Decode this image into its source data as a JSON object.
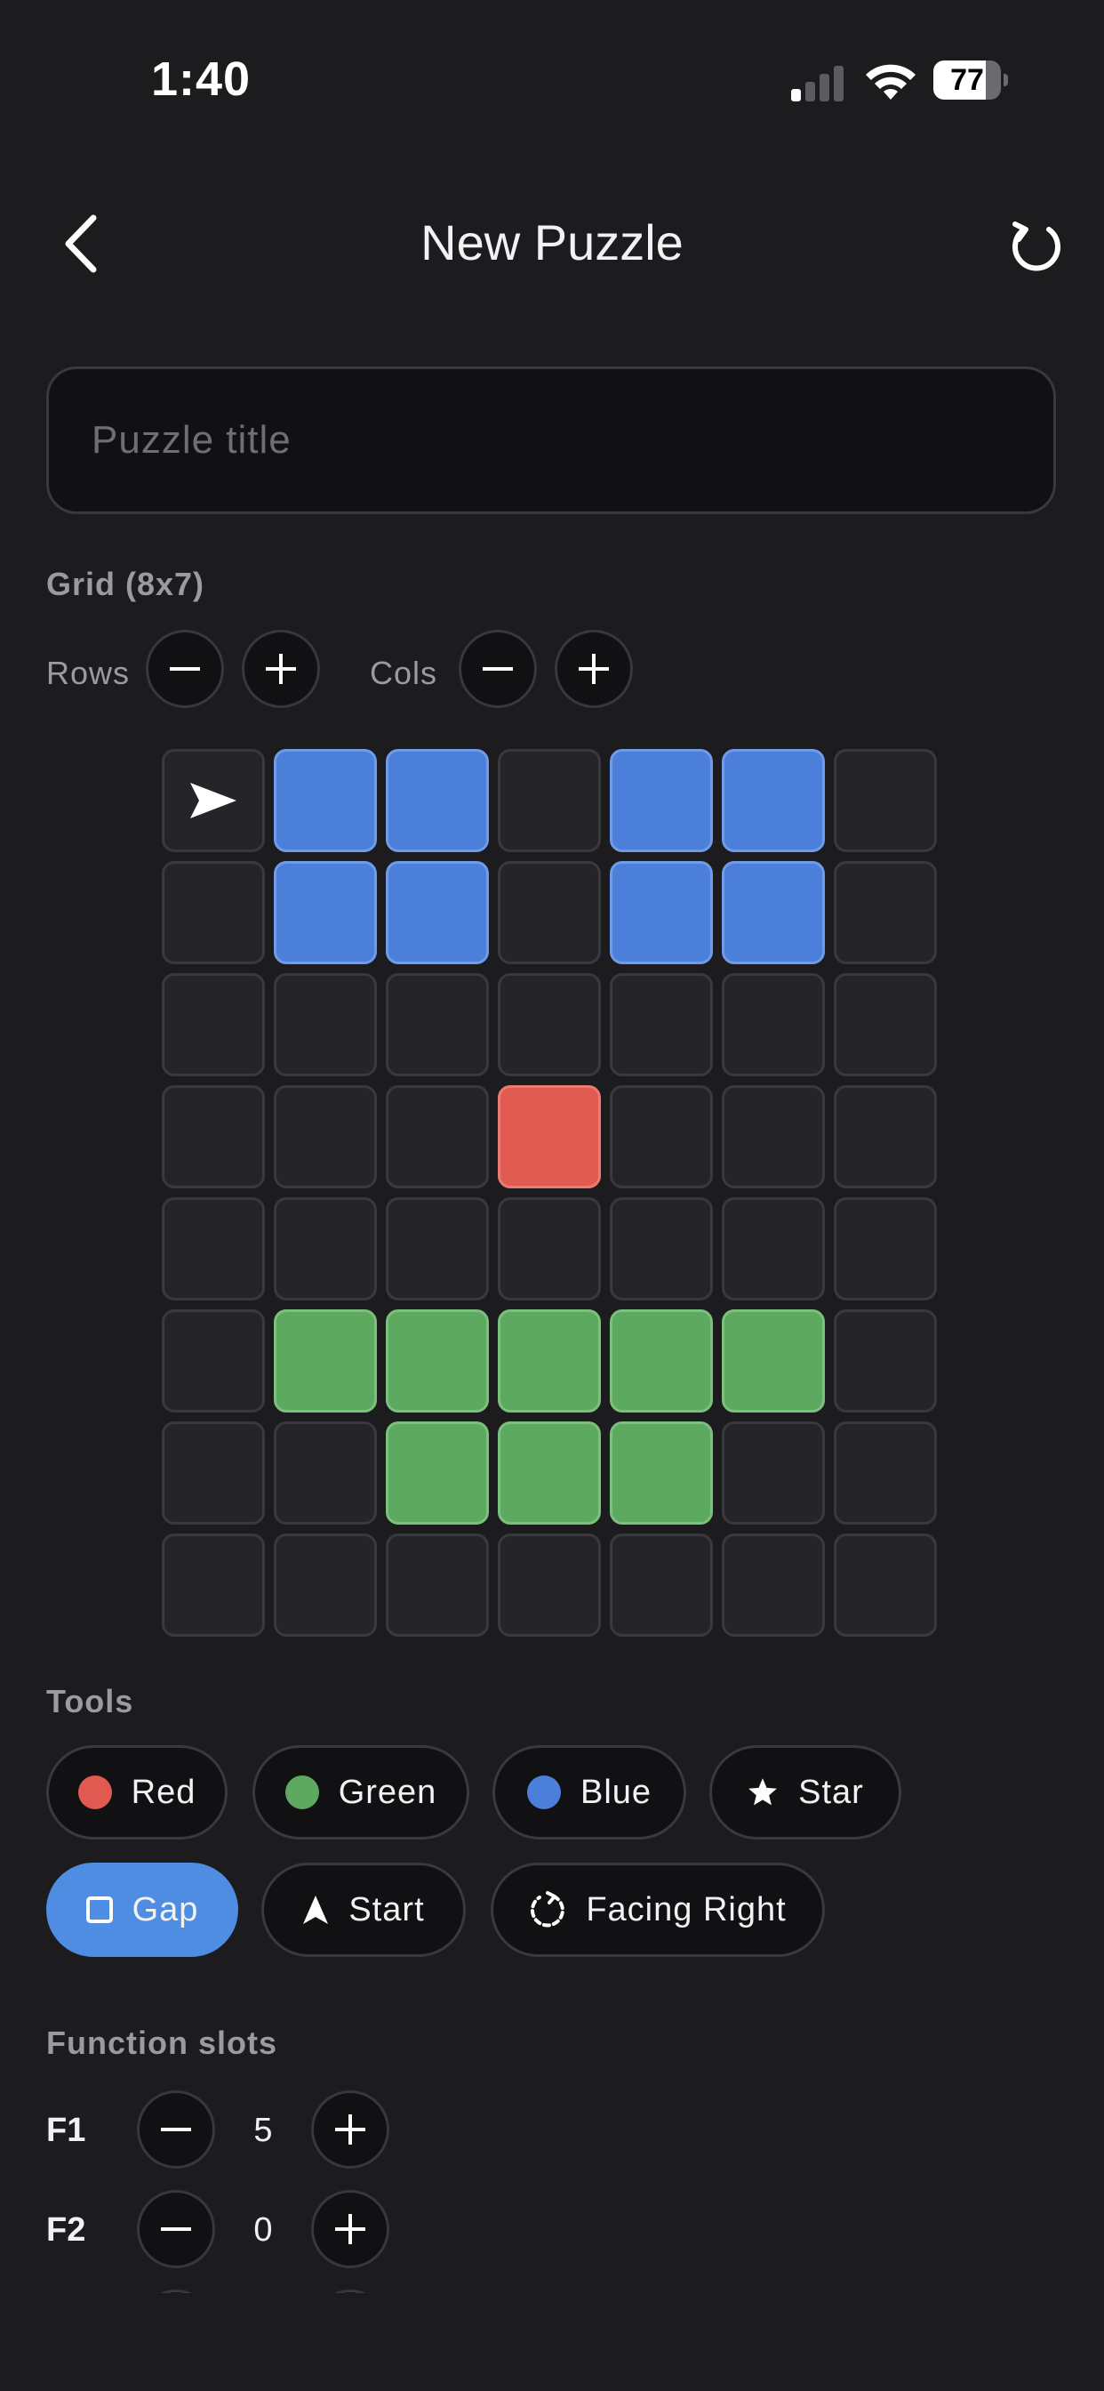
{
  "status": {
    "time": "1:40",
    "battery": "77",
    "battery_fraction": 0.77
  },
  "nav": {
    "title": "New Puzzle"
  },
  "title_input": {
    "placeholder": "Puzzle title",
    "value": ""
  },
  "grid_section": {
    "label": "Grid (8x7)",
    "rows_label": "Rows",
    "cols_label": "Cols"
  },
  "grid": {
    "rows": 8,
    "cols": 7,
    "colors": {
      "blue": "#4b7fd9",
      "red": "#e05a52",
      "green": "#5ea960",
      "empty": "#252529"
    },
    "cells": [
      [
        "start",
        "blue",
        "blue",
        "empty",
        "blue",
        "blue",
        "empty"
      ],
      [
        "empty",
        "blue",
        "blue",
        "empty",
        "blue",
        "blue",
        "empty"
      ],
      [
        "empty",
        "empty",
        "empty",
        "empty",
        "empty",
        "empty",
        "empty"
      ],
      [
        "empty",
        "empty",
        "empty",
        "red",
        "empty",
        "empty",
        "empty"
      ],
      [
        "empty",
        "empty",
        "empty",
        "empty",
        "empty",
        "empty",
        "empty"
      ],
      [
        "empty",
        "green",
        "green",
        "green",
        "green",
        "green",
        "empty"
      ],
      [
        "empty",
        "empty",
        "green",
        "green",
        "green",
        "empty",
        "empty"
      ],
      [
        "empty",
        "empty",
        "empty",
        "empty",
        "empty",
        "empty",
        "empty"
      ]
    ]
  },
  "tools": {
    "label": "Tools",
    "items": [
      {
        "label": "Red",
        "icon": "red-dot",
        "color": "#e05a52"
      },
      {
        "label": "Green",
        "icon": "green-dot",
        "color": "#5ea960"
      },
      {
        "label": "Blue",
        "icon": "blue-dot",
        "color": "#4b7fd9"
      },
      {
        "label": "Star",
        "icon": "star-icon"
      },
      {
        "label": "Gap",
        "icon": "square-icon",
        "selected": true,
        "color": "#4f8de3"
      },
      {
        "label": "Start",
        "icon": "arrow-up-icon"
      },
      {
        "label": "Facing Right",
        "icon": "rotate-icon"
      }
    ]
  },
  "function_slots": {
    "label": "Function slots",
    "slots": [
      {
        "name": "F1",
        "value": "5"
      },
      {
        "name": "F2",
        "value": "0"
      }
    ]
  }
}
